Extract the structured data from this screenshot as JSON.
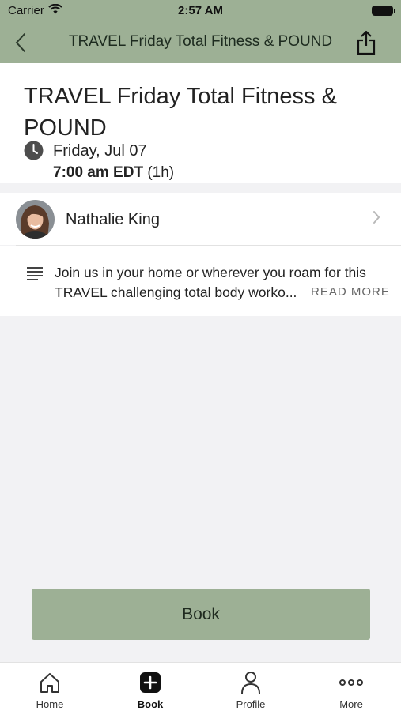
{
  "status_bar": {
    "carrier": "Carrier",
    "time": "2:57 AM"
  },
  "nav": {
    "title": "TRAVEL Friday Total Fitness & POUND"
  },
  "event": {
    "title": "TRAVEL Friday Total Fitness & POUND",
    "date": "Friday, Jul 07",
    "start_time": "7:00 am EDT",
    "duration": "(1h)"
  },
  "instructor": {
    "name": "Nathalie King"
  },
  "description": {
    "text": "Join us in your home or wherever you roam for this TRAVEL  challenging total body worko...",
    "read_more": "READ MORE"
  },
  "book_button": {
    "label": "Book"
  },
  "tabs": [
    {
      "label": "Home",
      "icon": "home-icon"
    },
    {
      "label": "Book",
      "icon": "plus-square-icon",
      "active": true
    },
    {
      "label": "Profile",
      "icon": "person-icon"
    },
    {
      "label": "More",
      "icon": "more-dots-icon"
    }
  ],
  "colors": {
    "accent": "#9db095",
    "background": "#f2f2f4"
  }
}
